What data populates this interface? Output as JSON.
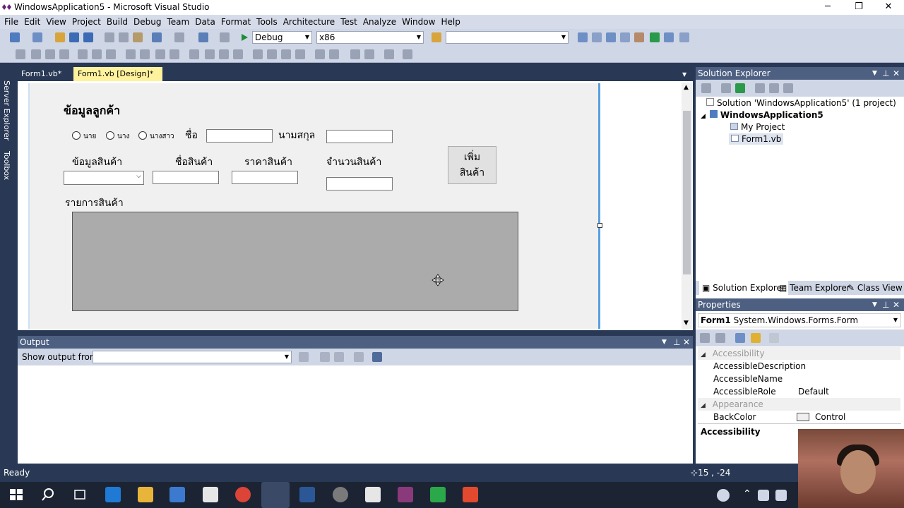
{
  "window": {
    "title": "WindowsApplication5 - Microsoft Visual Studio",
    "minimize": "─",
    "restore": "❐",
    "close": "✕"
  },
  "menu": [
    "File",
    "Edit",
    "View",
    "Project",
    "Build",
    "Debug",
    "Team",
    "Data",
    "Format",
    "Tools",
    "Architecture",
    "Test",
    "Analyze",
    "Window",
    "Help"
  ],
  "toolbar": {
    "config": "Debug",
    "platform": "x86",
    "find": ""
  },
  "left_strip": {
    "server_explorer": "Server Explorer",
    "toolbox": "Toolbox"
  },
  "doc_tabs": [
    {
      "label": "Form1.vb*"
    },
    {
      "label": "Form1.vb [Design]*",
      "active": true
    }
  ],
  "form": {
    "heading": "ข้อมูลลูกค้า",
    "radio_mr": "นาย",
    "radio_mrs": "นาง",
    "radio_miss": "นางสาว",
    "first_name_label": "ชื่อ",
    "last_name_label": "นามสกุล",
    "product_info_label": "ข้อมูลสินค้า",
    "product_name_label": "ชื่อสินค้า",
    "price_label": "ราคาสินค้า",
    "quantity_label": "จำนวนสินค้า",
    "add_button_line1": "เพิ่ม",
    "add_button_line2": "สินค้า",
    "list_label": "รายการสินค้า"
  },
  "output": {
    "title": "Output",
    "show_from_label": "Show output from:",
    "source": ""
  },
  "solution_explorer": {
    "title": "Solution Explorer",
    "solution": "Solution 'WindowsApplication5' (1 project)",
    "project": "WindowsApplication5",
    "my_project": "My Project",
    "form_file": "Form1.vb",
    "tabs": [
      "Solution Explorer",
      "Team Explorer",
      "Class View"
    ]
  },
  "properties": {
    "title": "Properties",
    "object_name": "Form1",
    "object_type": "System.Windows.Forms.Form",
    "categories": {
      "accessibility": "Accessibility",
      "appearance": "Appearance"
    },
    "rows": [
      {
        "name": "AccessibleDescription",
        "value": ""
      },
      {
        "name": "AccessibleName",
        "value": ""
      },
      {
        "name": "AccessibleRole",
        "value": "Default"
      },
      {
        "name": "BackColor",
        "value": "Control"
      }
    ],
    "description_title": "Accessibility"
  },
  "status": {
    "text": "Ready",
    "coords": "15 , -24"
  },
  "colors": {
    "vs_blue": "#293955",
    "panel_head": "#4d6082",
    "form_bg": "#f0f0f0",
    "listbox": "#ababab",
    "active_tab": "#fff29d"
  }
}
